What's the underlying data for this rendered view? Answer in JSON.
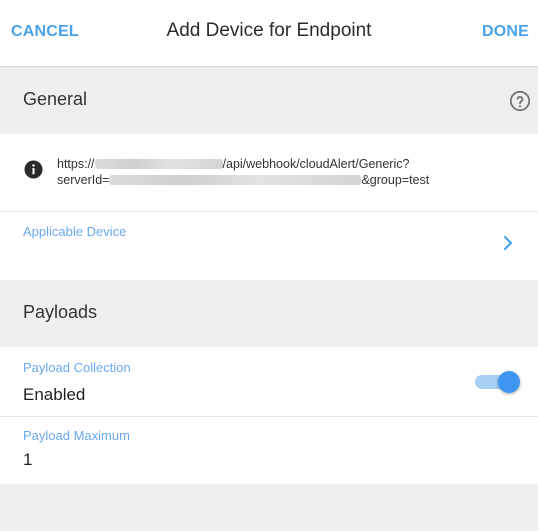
{
  "header": {
    "cancel_label": "CANCEL",
    "title": "Add Device for Endpoint",
    "done_label": "DONE"
  },
  "general": {
    "section_label": "General",
    "help_icon": "question-circle-icon",
    "info_icon": "info-filled-icon",
    "url_line1_prefix": "https://",
    "url_line1_suffix": "/api/webhook/cloudAlert/Generic?",
    "url_line2_prefix": "serverId=",
    "url_line2_suffix": "&group=test",
    "applicable_device_label": "Applicable Device",
    "chevron_icon": "chevron-right-icon"
  },
  "payloads": {
    "section_label": "Payloads",
    "collection_label": "Payload Collection",
    "collection_value": "Enabled",
    "collection_enabled": true,
    "maximum_label": "Payload Maximum",
    "maximum_value": "1"
  },
  "colors": {
    "accent": "#4aa3ea",
    "label_blue": "#6aaaf0",
    "toggle_knob": "#3f96f0",
    "toggle_track": "#a8d0f7",
    "section_bg": "#efefef"
  }
}
